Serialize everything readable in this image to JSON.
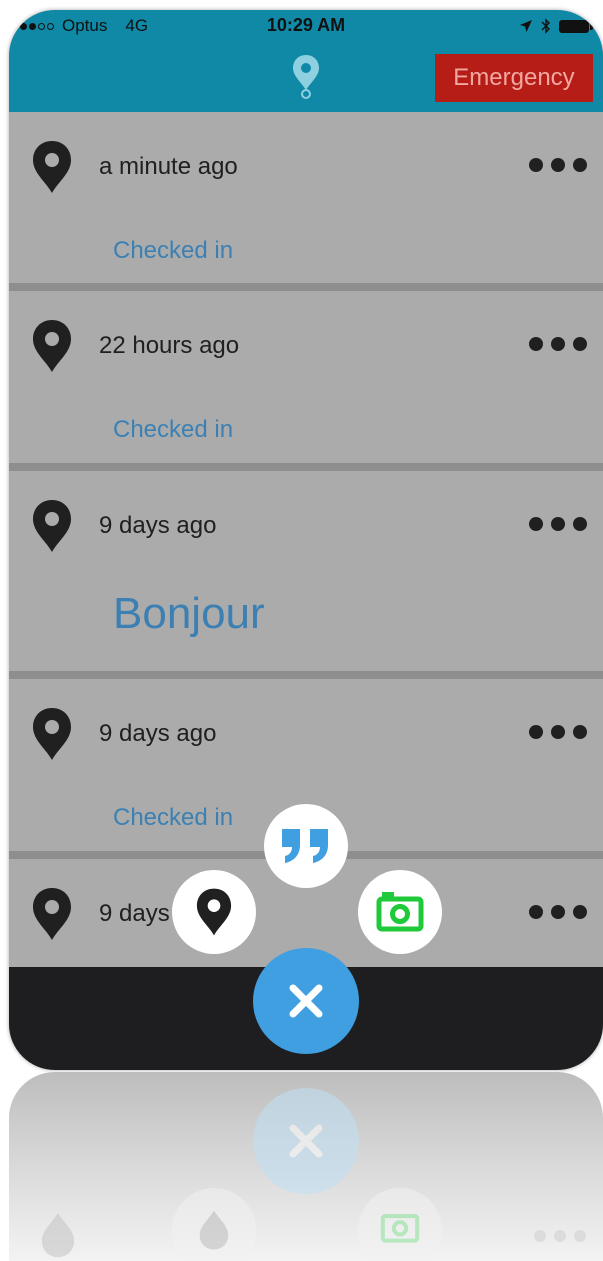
{
  "status_bar": {
    "carrier": "Optus",
    "network": "4G",
    "time": "10:29 AM"
  },
  "header": {
    "logo_icon": "map-pin-icon",
    "emergency_label": "Emergency"
  },
  "feed": {
    "entries": [
      {
        "time": "a minute ago",
        "status": "Checked in",
        "kind": "checkin"
      },
      {
        "time": "22 hours ago",
        "status": "Checked in",
        "kind": "checkin"
      },
      {
        "time": "9 days ago",
        "status": "Bonjour",
        "kind": "message"
      },
      {
        "time": "9 days ago",
        "status": "Checked in",
        "kind": "checkin"
      },
      {
        "time": "9 days ago",
        "status": "",
        "kind": "checkin"
      }
    ]
  },
  "fab_menu": {
    "actions": [
      {
        "name": "quote-icon"
      },
      {
        "name": "map-pin-icon"
      },
      {
        "name": "camera-icon"
      },
      {
        "name": "close-icon"
      }
    ]
  },
  "colors": {
    "header_bg": "#0f89a6",
    "emergency_bg": "#b51d16",
    "link_blue": "#3c80b3",
    "fab_blue": "#3f9fe0",
    "camera_green": "#1fc93a",
    "list_bg": "#ababab",
    "bottom_bar": "#1e1e20"
  }
}
